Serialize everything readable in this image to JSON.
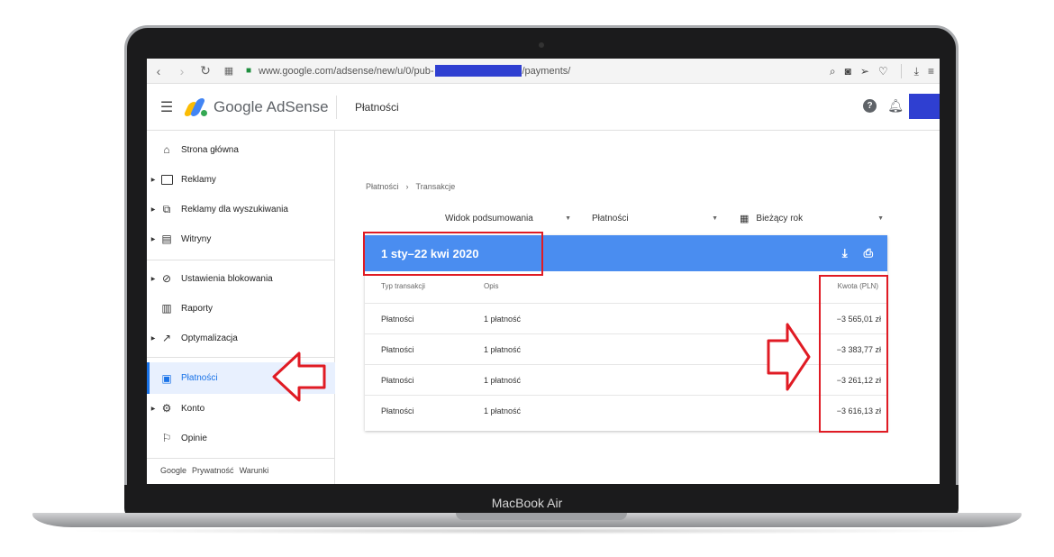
{
  "device": {
    "model_label": "MacBook Air"
  },
  "browser": {
    "url_prefix": "www.google.com/adsense/new/u/0/pub-",
    "url_suffix": "/payments/"
  },
  "app": {
    "logo_text": "Google AdSense",
    "page_title": "Płatności",
    "help_label": "?"
  },
  "sidebar": {
    "items": [
      {
        "label": "Strona główna",
        "icon": "home-icon"
      },
      {
        "label": "Reklamy",
        "icon": "ads-icon"
      },
      {
        "label": "Reklamy dla wyszukiwania",
        "icon": "search-ads-icon"
      },
      {
        "label": "Witryny",
        "icon": "sites-icon"
      },
      {
        "label": "Ustawienia blokowania",
        "icon": "block-icon"
      },
      {
        "label": "Raporty",
        "icon": "reports-icon"
      },
      {
        "label": "Optymalizacja",
        "icon": "trending-icon"
      },
      {
        "label": "Płatności",
        "icon": "payments-icon",
        "active": true
      },
      {
        "label": "Konto",
        "icon": "gear-icon"
      },
      {
        "label": "Opinie",
        "icon": "feedback-icon"
      }
    ],
    "footer": {
      "google": "Google",
      "privacy": "Prywatność",
      "terms": "Warunki"
    }
  },
  "main": {
    "breadcrumb": {
      "root": "Płatności",
      "separator": "›",
      "current": "Transakcje"
    },
    "filters": {
      "view": "Widok podsumowania",
      "type": "Płatności",
      "period": "Bieżący rok"
    },
    "card": {
      "date_range": "1 sty–22 kwi 2020",
      "columns": {
        "type": "Typ transakcji",
        "description": "Opis",
        "amount": "Kwota (PLN)"
      },
      "rows": [
        {
          "type": "Płatności",
          "description": "1 płatność",
          "amount": "−3 565,01 zł"
        },
        {
          "type": "Płatności",
          "description": "1 płatność",
          "amount": "−3 383,77 zł"
        },
        {
          "type": "Płatności",
          "description": "1 płatność",
          "amount": "−3 261,12 zł"
        },
        {
          "type": "Płatności",
          "description": "1 płatność",
          "amount": "−3 616,13 zł"
        }
      ]
    }
  },
  "colors": {
    "accent": "#1a73e8",
    "card_header": "#4a8df0",
    "annotation": "#e01b24",
    "redaction": "#2f3fd1"
  }
}
